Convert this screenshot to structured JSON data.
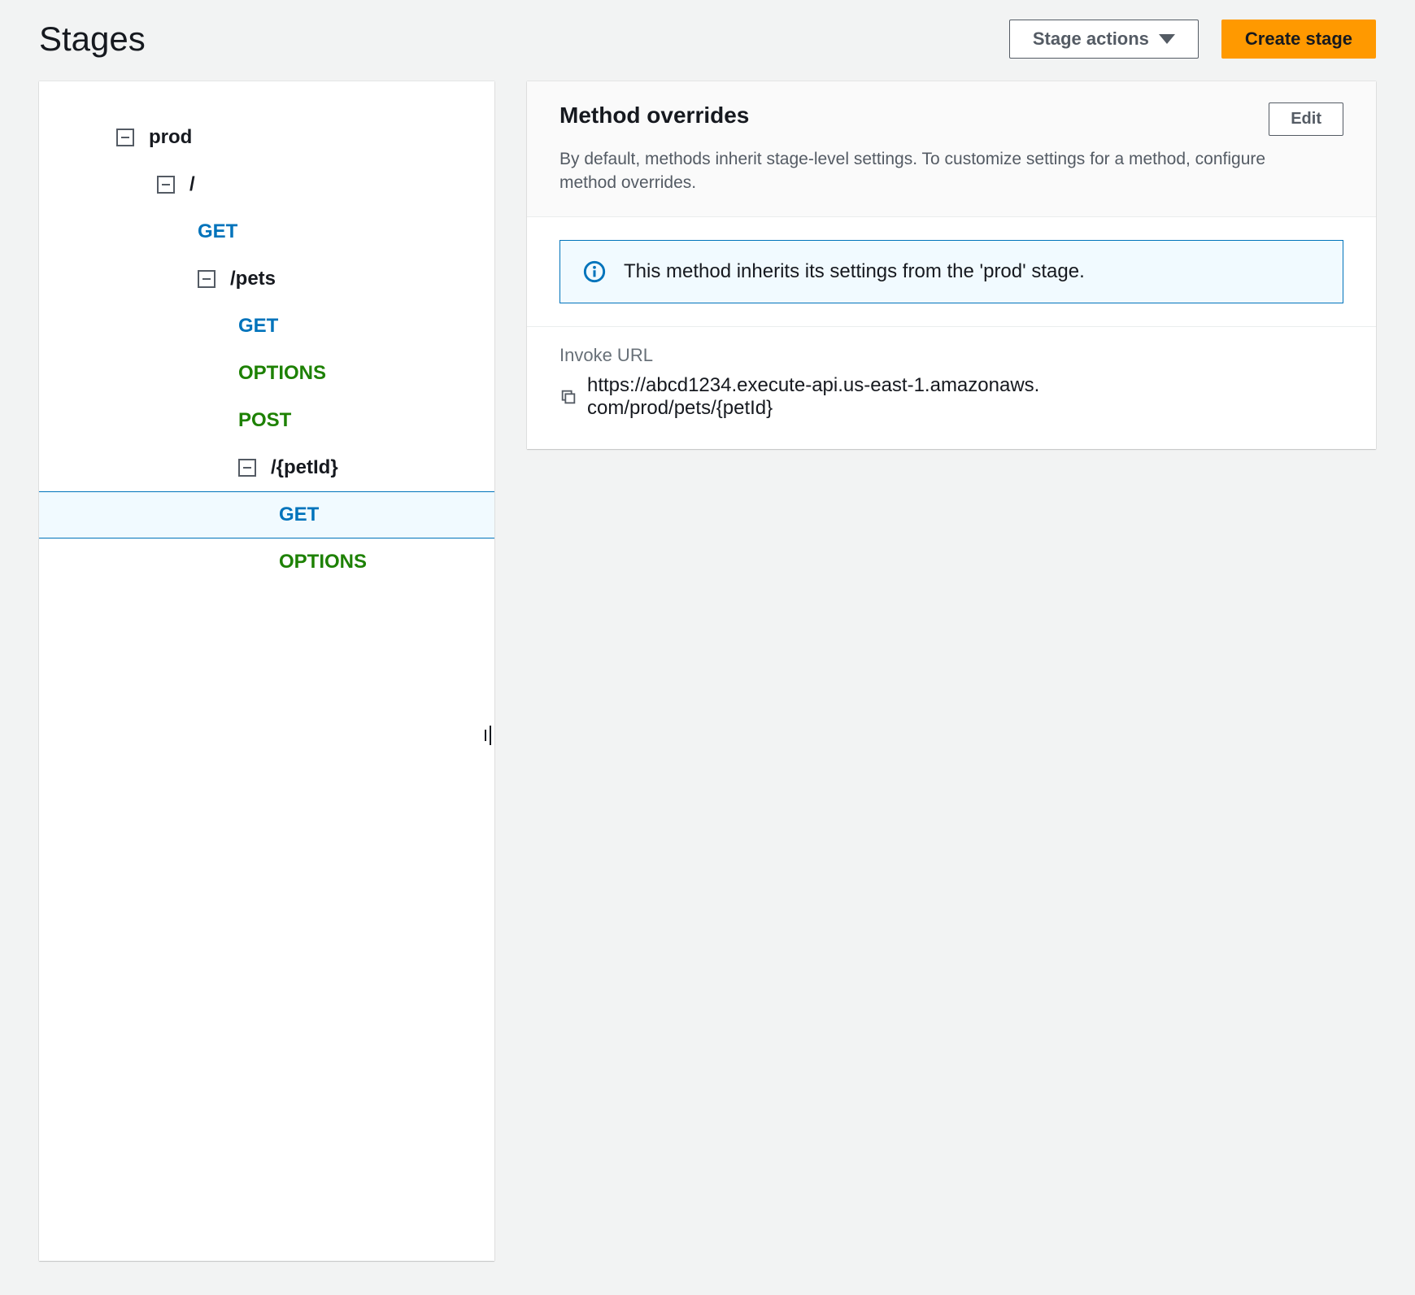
{
  "header": {
    "title": "Stages",
    "stage_actions_label": "Stage actions",
    "create_stage_label": "Create stage"
  },
  "tree": [
    {
      "label": "prod",
      "type": "stage",
      "indent": 0,
      "toggle": true
    },
    {
      "label": "/",
      "type": "resource",
      "indent": 1,
      "toggle": true
    },
    {
      "label": "GET",
      "type": "method",
      "method": "get",
      "indent": 2
    },
    {
      "label": "/pets",
      "type": "resource",
      "indent": 2,
      "toggle": true
    },
    {
      "label": "GET",
      "type": "method",
      "method": "get",
      "indent": 3
    },
    {
      "label": "OPTIONS",
      "type": "method",
      "method": "options",
      "indent": 3
    },
    {
      "label": "POST",
      "type": "method",
      "method": "post",
      "indent": 3
    },
    {
      "label": "/{petId}",
      "type": "resource",
      "indent": 3,
      "toggle": true
    },
    {
      "label": "GET",
      "type": "method",
      "method": "get",
      "indent": 4,
      "selected": true
    },
    {
      "label": "OPTIONS",
      "type": "method",
      "method": "options",
      "indent": 4
    }
  ],
  "overrides": {
    "title": "Method overrides",
    "description": "By default, methods inherit stage-level settings. To customize settings for a method, configure method overrides.",
    "edit_label": "Edit",
    "info_message": "This method inherits its settings from the 'prod' stage.",
    "invoke_label": "Invoke URL",
    "invoke_url": "https://abcd1234.execute-api.us-east-1.amazonaws.com/prod/pets/{petId}"
  }
}
